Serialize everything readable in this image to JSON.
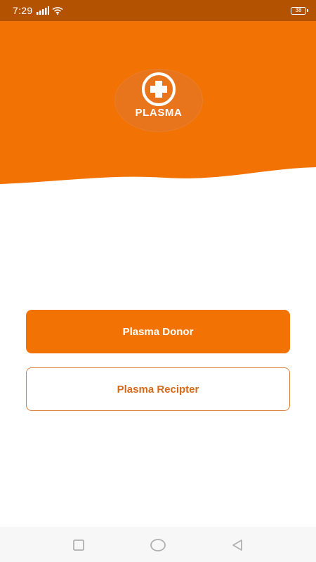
{
  "status_bar": {
    "time": "7:29",
    "battery_level": "38",
    "icons": [
      "signal-icon",
      "wifi-icon",
      "battery-icon"
    ]
  },
  "logo": {
    "text": "PLASMA",
    "icon": "medical-cross-icon"
  },
  "actions": {
    "donor_label": "Plasma Donor",
    "recipient_label": "Plasma Recipter"
  },
  "navigation": {
    "items": [
      "recent-apps-icon",
      "home-icon",
      "back-icon"
    ]
  },
  "colors": {
    "status_bar": "#b35200",
    "header": "#f27303",
    "logo_circle": "#e8741c",
    "primary_button": "#f27303",
    "secondary_text": "#d46a1c",
    "secondary_border": "#d9823f",
    "nav_bar": "#f7f7f7"
  }
}
